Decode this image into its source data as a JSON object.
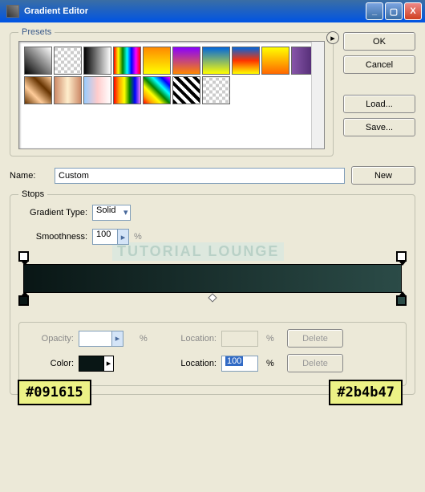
{
  "window": {
    "title": "Gradient Editor"
  },
  "buttons": {
    "ok": "OK",
    "cancel": "Cancel",
    "load": "Load...",
    "save": "Save...",
    "new": "New",
    "delete": "Delete"
  },
  "presets_legend": "Presets",
  "name_label": "Name:",
  "name_value": "Custom",
  "gradient_type_label": "Gradient Type:",
  "gradient_type_value": "Solid",
  "smoothness_label": "Smoothness:",
  "smoothness_value": "100",
  "percent": "%",
  "stops_legend": "Stops",
  "opacity_label": "Opacity:",
  "location_label": "Location:",
  "color_label": "Color:",
  "location_value": "100",
  "watermark": "TUTORIAL LOUNGE",
  "annot": {
    "left": "#091615",
    "right": "#2b4b47"
  },
  "gradient": {
    "start": "#091615",
    "end": "#2b4b47"
  }
}
